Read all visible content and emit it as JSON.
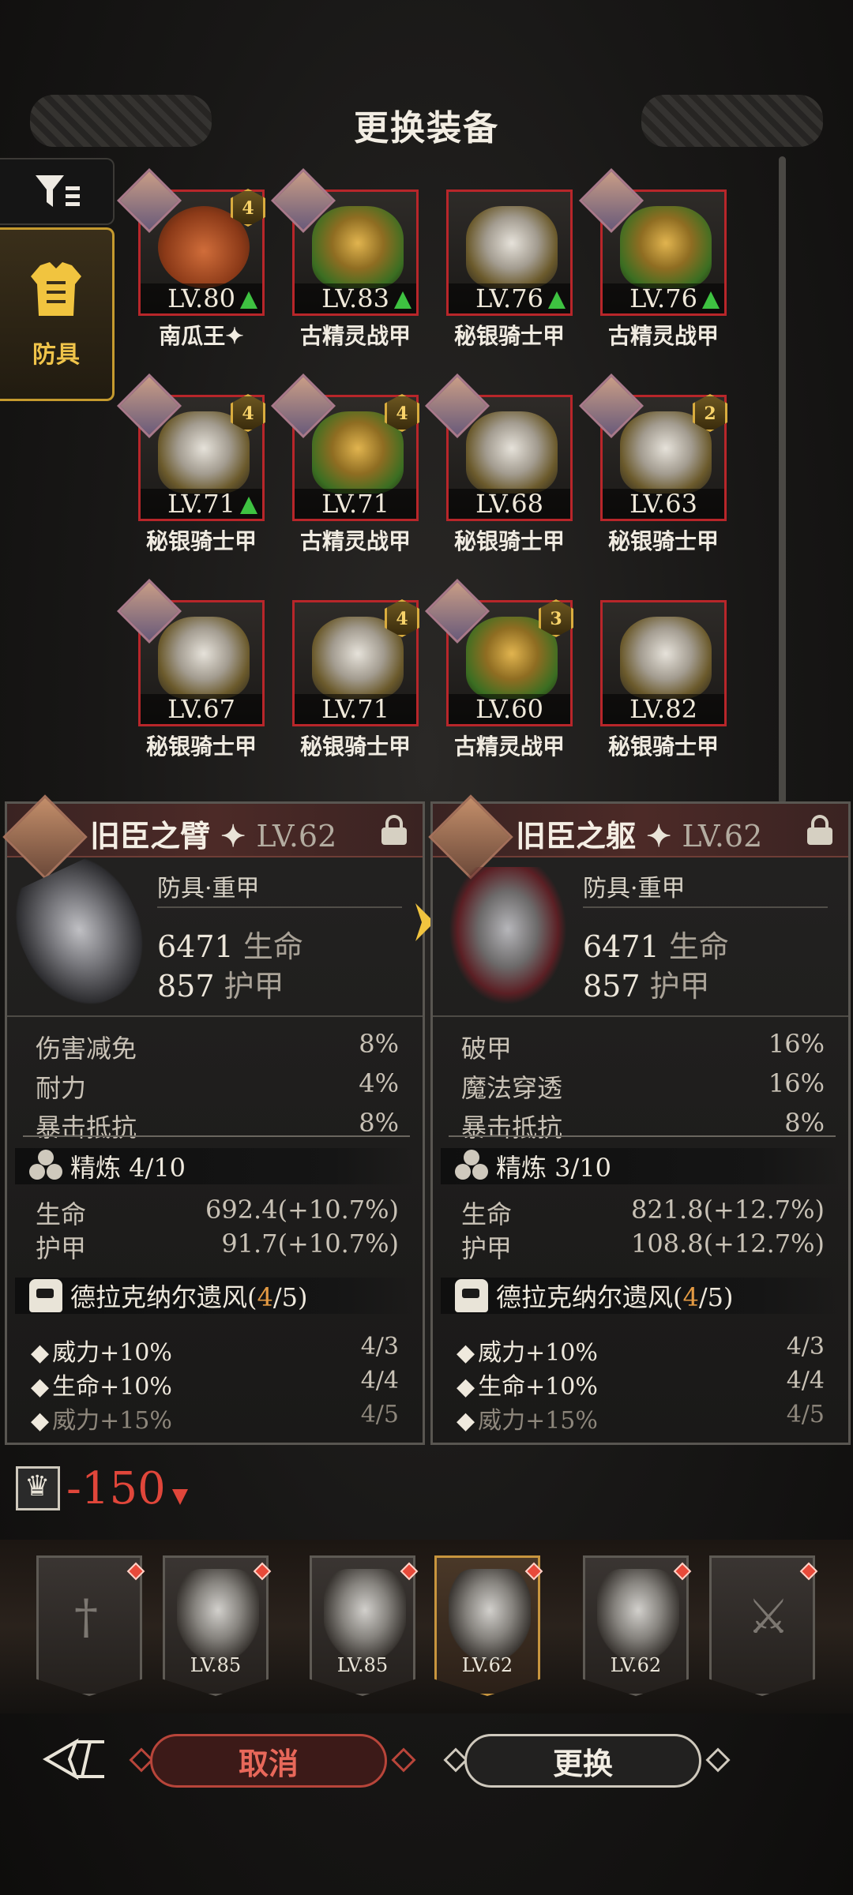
{
  "header": {
    "title": "更换装备"
  },
  "sidebar": {
    "filter_icon": "filter-icon",
    "active_tab": {
      "label": "防具",
      "icon": "chest-armor-icon"
    }
  },
  "items": [
    {
      "level": "LV.80",
      "name": "南瓜王",
      "suffix": "✦",
      "art": "pumpkin",
      "upgrade": true,
      "badge": "4",
      "avatar": true
    },
    {
      "level": "LV.83",
      "name": "古精灵战甲",
      "suffix": "",
      "art": "elf",
      "upgrade": true,
      "badge": "",
      "avatar": true
    },
    {
      "level": "LV.76",
      "name": "秘银骑士甲",
      "suffix": "",
      "art": "silver",
      "upgrade": true,
      "badge": "",
      "avatar": false
    },
    {
      "level": "LV.76",
      "name": "古精灵战甲",
      "suffix": "",
      "art": "elf",
      "upgrade": true,
      "badge": "",
      "avatar": true
    },
    {
      "level": "LV.71",
      "name": "秘银骑士甲",
      "suffix": "",
      "art": "silver",
      "upgrade": true,
      "badge": "4",
      "avatar": true
    },
    {
      "level": "LV.71",
      "name": "古精灵战甲",
      "suffix": "",
      "art": "elf",
      "upgrade": false,
      "badge": "4",
      "avatar": true
    },
    {
      "level": "LV.68",
      "name": "秘银骑士甲",
      "suffix": "",
      "art": "silver",
      "upgrade": false,
      "badge": "",
      "avatar": true
    },
    {
      "level": "LV.63",
      "name": "秘银骑士甲",
      "suffix": "",
      "art": "silver",
      "upgrade": false,
      "badge": "2",
      "avatar": true
    },
    {
      "level": "LV.67",
      "name": "秘银骑士甲",
      "suffix": "",
      "art": "silver",
      "upgrade": false,
      "badge": "",
      "avatar": true
    },
    {
      "level": "LV.71",
      "name": "秘银骑士甲",
      "suffix": "",
      "art": "silver",
      "upgrade": false,
      "badge": "4",
      "avatar": false
    },
    {
      "level": "LV.60",
      "name": "古精灵战甲",
      "suffix": "",
      "art": "elf",
      "upgrade": false,
      "badge": "3",
      "avatar": true
    },
    {
      "level": "LV.82",
      "name": "秘银骑士甲",
      "suffix": "",
      "art": "silver",
      "upgrade": false,
      "badge": "",
      "avatar": false
    }
  ],
  "compare": {
    "current": {
      "name": "旧臣之臂",
      "star": "✦",
      "level": "LV.62",
      "type": "防具·重甲",
      "hp_value": "6471",
      "hp_label": "生命",
      "armor_value": "857",
      "armor_label": "护甲",
      "subs": [
        {
          "k": "伤害减免",
          "v": "8%"
        },
        {
          "k": "耐力",
          "v": "4%"
        },
        {
          "k": "暴击抵抗",
          "v": "8%"
        }
      ],
      "refine_label": "精炼 4/10",
      "refine_stats": [
        {
          "k": "生命",
          "v": "692.4(+10.7%)"
        },
        {
          "k": "护甲",
          "v": "91.7(+10.7%)"
        }
      ],
      "set_name": "德拉克纳尔遗风(",
      "set_have": "4",
      "set_total": "/5)",
      "set_bonus": [
        {
          "k": "威力+10%",
          "v": "4/3",
          "active": true
        },
        {
          "k": "生命+10%",
          "v": "4/4",
          "active": true
        },
        {
          "k": "威力+15%",
          "v": "4/5",
          "active": false
        }
      ]
    },
    "candidate": {
      "name": "旧臣之躯",
      "star": "✦",
      "level": "LV.62",
      "type": "防具·重甲",
      "hp_value": "6471",
      "hp_label": "生命",
      "armor_value": "857",
      "armor_label": "护甲",
      "subs": [
        {
          "k": "破甲",
          "v": "16%"
        },
        {
          "k": "魔法穿透",
          "v": "16%"
        },
        {
          "k": "暴击抵抗",
          "v": "8%"
        }
      ],
      "refine_label": "精炼 3/10",
      "refine_stats": [
        {
          "k": "生命",
          "v": "821.8(+12.7%)"
        },
        {
          "k": "护甲",
          "v": "108.8(+12.7%)"
        }
      ],
      "set_name": "德拉克纳尔遗风(",
      "set_have": "4",
      "set_total": "/5)",
      "set_bonus": [
        {
          "k": "威力+10%",
          "v": "4/3",
          "active": true
        },
        {
          "k": "生命+10%",
          "v": "4/4",
          "active": true
        },
        {
          "k": "威力+15%",
          "v": "4/5",
          "active": false
        }
      ]
    }
  },
  "power_change": "-150",
  "equipment_bar": [
    {
      "level": "",
      "icon": "sword-slot-icon",
      "active": false,
      "dot": true
    },
    {
      "level": "LV.85",
      "icon": "greatsword-icon",
      "active": false,
      "dot": true
    },
    {
      "level": "LV.85",
      "icon": "helmet-icon",
      "active": false,
      "dot": true
    },
    {
      "level": "LV.62",
      "icon": "gauntlet-icon",
      "active": true,
      "dot": true
    },
    {
      "level": "LV.62",
      "icon": "armor-icon",
      "active": false,
      "dot": true
    },
    {
      "level": "",
      "icon": "boots-slot-icon",
      "active": false,
      "dot": true
    }
  ],
  "buttons": {
    "cancel": "取消",
    "swap": "更换"
  },
  "colors": {
    "frame_red": "#b8262a",
    "gold": "#d9ac3e",
    "upgrade_green": "#3ec241",
    "power_red": "#e0463a",
    "set_orange": "#e39a43"
  }
}
